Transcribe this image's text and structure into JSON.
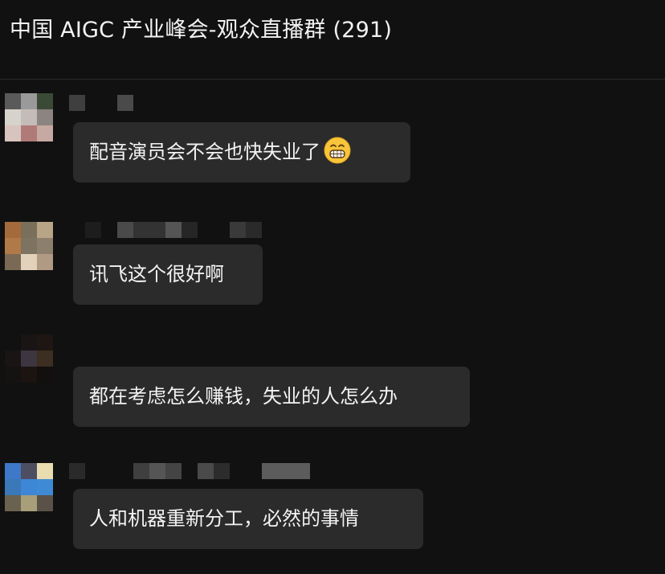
{
  "header": {
    "title": "中国 AIGC 产业峰会-观众直播群 (291)"
  },
  "messages": [
    {
      "text": "配音演员会不会也快失业了",
      "emoji": "grinning-face-icon"
    },
    {
      "text": "讯飞这个很好啊"
    },
    {
      "text": "都在考虑怎么赚钱，失业的人怎么办"
    },
    {
      "text": "人和机器重新分工，必然的事情"
    }
  ],
  "colors": {
    "background": "#111111",
    "bubble": "#2b2b2b",
    "text": "#f3f3f3",
    "divider": "#2a2a2a"
  }
}
